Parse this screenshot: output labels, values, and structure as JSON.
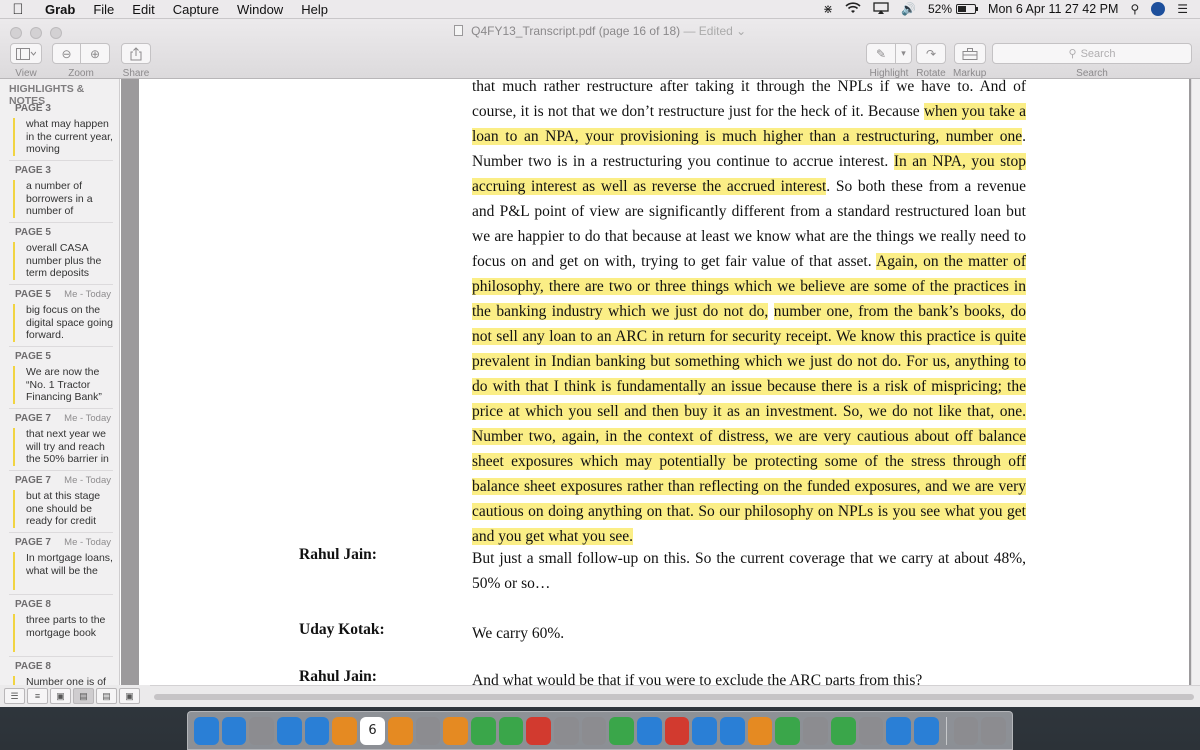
{
  "menubar": {
    "app_name": "Grab",
    "menus": [
      "File",
      "Edit",
      "Capture",
      "Window",
      "Help"
    ],
    "battery_percent": "52%",
    "battery_level": 0.52,
    "clock": "Mon 6 Apr  11 27 42 PM"
  },
  "window": {
    "title": "Q4FY13_Transcript.pdf (page 16 of 18)",
    "edited": "— Edited",
    "toolbar": {
      "view_label": "View",
      "zoom_label": "Zoom",
      "share_label": "Share",
      "highlight_label": "Highlight",
      "rotate_label": "Rotate",
      "markup_label": "Markup",
      "search_label": "Search",
      "search_placeholder": "Search"
    }
  },
  "sidebar": {
    "header": "HIGHLIGHTS & NOTES",
    "notes": [
      {
        "page": "PAGE 3",
        "meta": "",
        "text": "what may happen in the current year, moving"
      },
      {
        "page": "PAGE 3",
        "meta": "",
        "text": "a number of borrowers in a number of"
      },
      {
        "page": "PAGE 5",
        "meta": "",
        "text": "overall CASA number plus the term deposits"
      },
      {
        "page": "PAGE 5",
        "meta": "Me - Today",
        "text": " big focus on the digital space going forward."
      },
      {
        "page": "PAGE 5",
        "meta": "",
        "text": "We are now the “No. 1 Tractor Financing Bank”"
      },
      {
        "page": "PAGE 7",
        "meta": "Me - Today",
        "text": "that next year we will try and reach the 50% barrier in"
      },
      {
        "page": "PAGE 7",
        "meta": "Me - Today",
        "text": "but at this stage one should be ready for credit"
      },
      {
        "page": "PAGE 7",
        "meta": "Me - Today",
        "text": "In mortgage loans, what will be the"
      },
      {
        "page": "PAGE 8",
        "meta": "",
        "text": " three parts to the mortgage book"
      },
      {
        "page": "PAGE 8",
        "meta": "",
        "text": "Number one is of"
      }
    ]
  },
  "document": {
    "paragraph": [
      {
        "t": "that much rather restructure after taking it through the NPLs if we have to. And of course, it is not that we don’t restructure just for the heck of it. Because ",
        "h": false
      },
      {
        "t": "when you take a loan to an NPA, your provisioning is much higher than a restructuring, number one",
        "h": true
      },
      {
        "t": ". Number two is in a restructuring you continue to accrue interest. ",
        "h": false
      },
      {
        "t": "In an NPA, you stop accruing interest as well as reverse the accrued interest",
        "h": true
      },
      {
        "t": ". So both these from a revenue and P&L point of view are significantly different from a standard restructured loan but we are happier to do that because at least we know what are the things we really need to focus on and get on with, trying to get fair value of that asset. ",
        "h": false
      },
      {
        "t": "Again, on the matter of philosophy, there are two or three things which we believe are some of the practices in the banking industry which we just do not do,",
        "h": true
      },
      {
        "t": " ",
        "h": false
      },
      {
        "t": "number one, from the bank’s books, do not sell any loan to an ARC in return for security receipt. We know this practice is quite prevalent in Indian banking but something which we just do not do. For us, anything to do with that I think is fundamentally an issue because there is a risk of mispricing; the price at which you sell and then buy it as an investment. So, we do not like that, one. Number two, again, in the context of distress, we are very cautious about off balance sheet exposures which may potentially be protecting some of the stress through off balance sheet exposures rather than reflecting on the funded exposures, and we are very cautious on doing anything on that. So our philosophy on NPLs is you see what you get and you get what you see.",
        "h": true
      }
    ],
    "exchanges": [
      {
        "speaker": "Rahul Jain:",
        "text": "But just a small follow-up on this. So the current coverage that we carry at about 48%, 50% or so…"
      },
      {
        "speaker": "Uday Kotak:",
        "text": "We carry 60%."
      },
      {
        "speaker": "Rahul Jain:",
        "text": "And what would be that if you were to exclude the ARC parts from this?"
      }
    ]
  },
  "dock": {
    "calendar_day": "6",
    "icons": [
      "finder-icon",
      "siri-icon",
      "launchpad-icon",
      "safari-icon",
      "preview-icon",
      "notefile-icon",
      "calendar-icon",
      "notes-icon",
      "reminders-icon",
      "photos-icon",
      "maps-icon",
      "facetime-icon",
      "photobooth-icon",
      "textedit-icon",
      "calculator-icon",
      "numbers-icon",
      "keynote-icon",
      "itunes-icon",
      "appstore-icon",
      "word-icon",
      "firefox-icon",
      "chrome-icon",
      "settings-icon",
      "excel-icon",
      "grab-icon",
      "skype-icon",
      "mail-icon",
      "downloads-icon",
      "trash-icon"
    ],
    "colors": {
      "blue": "#2a7fd6",
      "green": "#3aa64a",
      "red": "#d23a2f",
      "orange": "#e58a22",
      "gray": "#8c8c90"
    }
  }
}
